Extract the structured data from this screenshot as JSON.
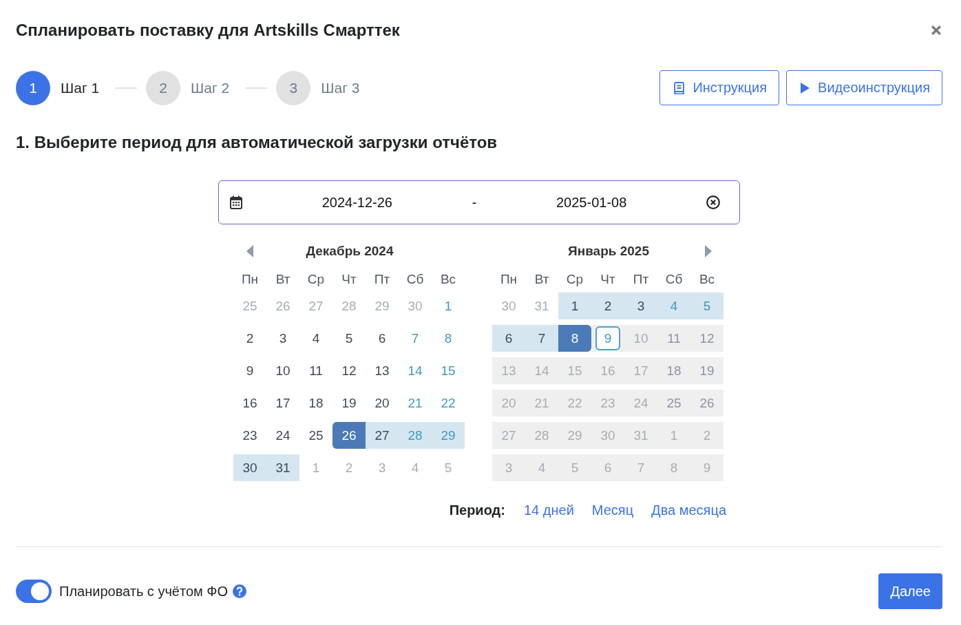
{
  "dialog": {
    "title": "Спланировать поставку для Artskills Смарттек"
  },
  "steps": [
    {
      "number": "1",
      "label": "Шаг 1",
      "selected": true
    },
    {
      "number": "2",
      "label": "Шаг 2",
      "selected": false
    },
    {
      "number": "3",
      "label": "Шаг 3",
      "selected": false
    }
  ],
  "help_buttons": [
    {
      "label": "Инструкция",
      "kind": "doc"
    },
    {
      "label": "Видеоинструкция",
      "kind": "video"
    }
  ],
  "section_title": "1. Выберите период для автоматической загрузки отчётов",
  "date_range": {
    "start": "2024-12-26",
    "separator": "-",
    "end": "2025-01-08"
  },
  "calendars": [
    {
      "title": "Декабрь 2024",
      "prev_arrow": true,
      "next_arrow": false,
      "weekdays": [
        "Пн",
        "Вт",
        "Ср",
        "Чт",
        "Пт",
        "Сб",
        "Вс"
      ],
      "days": [
        {
          "text": "25",
          "kind": "outside",
          "selected": false,
          "in_range": false,
          "disabled": false,
          "today": false
        },
        {
          "text": "26",
          "kind": "outside",
          "selected": false,
          "in_range": false,
          "disabled": false,
          "today": false
        },
        {
          "text": "27",
          "kind": "outside",
          "selected": false,
          "in_range": false,
          "disabled": false,
          "today": false
        },
        {
          "text": "28",
          "kind": "outside",
          "selected": false,
          "in_range": false,
          "disabled": false,
          "today": false
        },
        {
          "text": "29",
          "kind": "outside",
          "selected": false,
          "in_range": false,
          "disabled": false,
          "today": false
        },
        {
          "text": "30",
          "kind": "outside",
          "selected": false,
          "in_range": false,
          "disabled": false,
          "today": false
        },
        {
          "text": "1",
          "kind": "weekend",
          "selected": false,
          "in_range": false,
          "disabled": false,
          "today": false
        },
        {
          "text": "2",
          "kind": "weekday",
          "selected": false,
          "in_range": false,
          "disabled": false,
          "today": false
        },
        {
          "text": "3",
          "kind": "weekday",
          "selected": false,
          "in_range": false,
          "disabled": false,
          "today": false
        },
        {
          "text": "4",
          "kind": "weekday",
          "selected": false,
          "in_range": false,
          "disabled": false,
          "today": false
        },
        {
          "text": "5",
          "kind": "weekday",
          "selected": false,
          "in_range": false,
          "disabled": false,
          "today": false
        },
        {
          "text": "6",
          "kind": "weekday",
          "selected": false,
          "in_range": false,
          "disabled": false,
          "today": false
        },
        {
          "text": "7",
          "kind": "weekend",
          "selected": false,
          "in_range": false,
          "disabled": false,
          "today": false
        },
        {
          "text": "8",
          "kind": "weekend",
          "selected": false,
          "in_range": false,
          "disabled": false,
          "today": false
        },
        {
          "text": "9",
          "kind": "weekday",
          "selected": false,
          "in_range": false,
          "disabled": false,
          "today": false
        },
        {
          "text": "10",
          "kind": "weekday",
          "selected": false,
          "in_range": false,
          "disabled": false,
          "today": false
        },
        {
          "text": "11",
          "kind": "weekday",
          "selected": false,
          "in_range": false,
          "disabled": false,
          "today": false
        },
        {
          "text": "12",
          "kind": "weekday",
          "selected": false,
          "in_range": false,
          "disabled": false,
          "today": false
        },
        {
          "text": "13",
          "kind": "weekday",
          "selected": false,
          "in_range": false,
          "disabled": false,
          "today": false
        },
        {
          "text": "14",
          "kind": "weekend",
          "selected": false,
          "in_range": false,
          "disabled": false,
          "today": false
        },
        {
          "text": "15",
          "kind": "weekend",
          "selected": false,
          "in_range": false,
          "disabled": false,
          "today": false
        },
        {
          "text": "16",
          "kind": "weekday",
          "selected": false,
          "in_range": false,
          "disabled": false,
          "today": false
        },
        {
          "text": "17",
          "kind": "weekday",
          "selected": false,
          "in_range": false,
          "disabled": false,
          "today": false
        },
        {
          "text": "18",
          "kind": "weekday",
          "selected": false,
          "in_range": false,
          "disabled": false,
          "today": false
        },
        {
          "text": "19",
          "kind": "weekday",
          "selected": false,
          "in_range": false,
          "disabled": false,
          "today": false
        },
        {
          "text": "20",
          "kind": "weekday",
          "selected": false,
          "in_range": false,
          "disabled": false,
          "today": false
        },
        {
          "text": "21",
          "kind": "weekend",
          "selected": false,
          "in_range": false,
          "disabled": false,
          "today": false
        },
        {
          "text": "22",
          "kind": "weekend",
          "selected": false,
          "in_range": false,
          "disabled": false,
          "today": false
        },
        {
          "text": "23",
          "kind": "weekday",
          "selected": false,
          "in_range": false,
          "disabled": false,
          "today": false
        },
        {
          "text": "24",
          "kind": "weekday",
          "selected": false,
          "in_range": false,
          "disabled": false,
          "today": false
        },
        {
          "text": "25",
          "kind": "weekday",
          "selected": false,
          "in_range": false,
          "disabled": false,
          "today": false
        },
        {
          "text": "26",
          "kind": "weekday",
          "selected": true,
          "in_range": false,
          "disabled": false,
          "today": false
        },
        {
          "text": "27",
          "kind": "weekday",
          "selected": false,
          "in_range": true,
          "disabled": false,
          "today": false
        },
        {
          "text": "28",
          "kind": "weekend",
          "selected": false,
          "in_range": true,
          "disabled": false,
          "today": false
        },
        {
          "text": "29",
          "kind": "weekend",
          "selected": false,
          "in_range": true,
          "disabled": false,
          "today": false
        },
        {
          "text": "30",
          "kind": "weekday",
          "selected": false,
          "in_range": true,
          "disabled": false,
          "today": false
        },
        {
          "text": "31",
          "kind": "weekday",
          "selected": false,
          "in_range": true,
          "disabled": false,
          "today": false
        },
        {
          "text": "1",
          "kind": "outside",
          "selected": false,
          "in_range": false,
          "disabled": false,
          "today": false
        },
        {
          "text": "2",
          "kind": "outside",
          "selected": false,
          "in_range": false,
          "disabled": false,
          "today": false
        },
        {
          "text": "3",
          "kind": "outside",
          "selected": false,
          "in_range": false,
          "disabled": false,
          "today": false
        },
        {
          "text": "4",
          "kind": "outside",
          "selected": false,
          "in_range": false,
          "disabled": false,
          "today": false
        },
        {
          "text": "5",
          "kind": "outside",
          "selected": false,
          "in_range": false,
          "disabled": false,
          "today": false
        }
      ]
    },
    {
      "title": "Январь 2025",
      "prev_arrow": false,
      "next_arrow": true,
      "weekdays": [
        "Пн",
        "Вт",
        "Ср",
        "Чт",
        "Пт",
        "Сб",
        "Вс"
      ],
      "days": [
        {
          "text": "30",
          "kind": "outside",
          "selected": false,
          "in_range": false,
          "disabled": false,
          "today": false
        },
        {
          "text": "31",
          "kind": "outside",
          "selected": false,
          "in_range": false,
          "disabled": false,
          "today": false
        },
        {
          "text": "1",
          "kind": "weekday",
          "selected": false,
          "in_range": true,
          "disabled": false,
          "today": false
        },
        {
          "text": "2",
          "kind": "weekday",
          "selected": false,
          "in_range": true,
          "disabled": false,
          "today": false
        },
        {
          "text": "3",
          "kind": "weekday",
          "selected": false,
          "in_range": true,
          "disabled": false,
          "today": false
        },
        {
          "text": "4",
          "kind": "weekend",
          "selected": false,
          "in_range": true,
          "disabled": false,
          "today": false
        },
        {
          "text": "5",
          "kind": "weekend",
          "selected": false,
          "in_range": true,
          "disabled": false,
          "today": false
        },
        {
          "text": "6",
          "kind": "weekday",
          "selected": false,
          "in_range": true,
          "disabled": false,
          "today": false
        },
        {
          "text": "7",
          "kind": "weekday",
          "selected": false,
          "in_range": true,
          "disabled": false,
          "today": false
        },
        {
          "text": "8",
          "kind": "weekday",
          "selected": true,
          "in_range": false,
          "disabled": false,
          "today": false
        },
        {
          "text": "9",
          "kind": "weekday",
          "selected": false,
          "in_range": false,
          "disabled": true,
          "today": true
        },
        {
          "text": "10",
          "kind": "weekday",
          "selected": false,
          "in_range": false,
          "disabled": true,
          "today": false
        },
        {
          "text": "11",
          "kind": "weekend",
          "selected": false,
          "in_range": false,
          "disabled": true,
          "today": false
        },
        {
          "text": "12",
          "kind": "weekend",
          "selected": false,
          "in_range": false,
          "disabled": true,
          "today": false
        },
        {
          "text": "13",
          "kind": "weekday",
          "selected": false,
          "in_range": false,
          "disabled": true,
          "today": false
        },
        {
          "text": "14",
          "kind": "weekday",
          "selected": false,
          "in_range": false,
          "disabled": true,
          "today": false
        },
        {
          "text": "15",
          "kind": "weekday",
          "selected": false,
          "in_range": false,
          "disabled": true,
          "today": false
        },
        {
          "text": "16",
          "kind": "weekday",
          "selected": false,
          "in_range": false,
          "disabled": true,
          "today": false
        },
        {
          "text": "17",
          "kind": "weekday",
          "selected": false,
          "in_range": false,
          "disabled": true,
          "today": false
        },
        {
          "text": "18",
          "kind": "weekend",
          "selected": false,
          "in_range": false,
          "disabled": true,
          "today": false
        },
        {
          "text": "19",
          "kind": "weekend",
          "selected": false,
          "in_range": false,
          "disabled": true,
          "today": false
        },
        {
          "text": "20",
          "kind": "weekday",
          "selected": false,
          "in_range": false,
          "disabled": true,
          "today": false
        },
        {
          "text": "21",
          "kind": "weekday",
          "selected": false,
          "in_range": false,
          "disabled": true,
          "today": false
        },
        {
          "text": "22",
          "kind": "weekday",
          "selected": false,
          "in_range": false,
          "disabled": true,
          "today": false
        },
        {
          "text": "23",
          "kind": "weekday",
          "selected": false,
          "in_range": false,
          "disabled": true,
          "today": false
        },
        {
          "text": "24",
          "kind": "weekday",
          "selected": false,
          "in_range": false,
          "disabled": true,
          "today": false
        },
        {
          "text": "25",
          "kind": "weekend",
          "selected": false,
          "in_range": false,
          "disabled": true,
          "today": false
        },
        {
          "text": "26",
          "kind": "weekend",
          "selected": false,
          "in_range": false,
          "disabled": true,
          "today": false
        },
        {
          "text": "27",
          "kind": "weekday",
          "selected": false,
          "in_range": false,
          "disabled": true,
          "today": false
        },
        {
          "text": "28",
          "kind": "weekday",
          "selected": false,
          "in_range": false,
          "disabled": true,
          "today": false
        },
        {
          "text": "29",
          "kind": "weekday",
          "selected": false,
          "in_range": false,
          "disabled": true,
          "today": false
        },
        {
          "text": "30",
          "kind": "weekday",
          "selected": false,
          "in_range": false,
          "disabled": true,
          "today": false
        },
        {
          "text": "31",
          "kind": "weekday",
          "selected": false,
          "in_range": false,
          "disabled": true,
          "today": false
        },
        {
          "text": "1",
          "kind": "outside",
          "selected": false,
          "in_range": false,
          "disabled": true,
          "today": false
        },
        {
          "text": "2",
          "kind": "outside",
          "selected": false,
          "in_range": false,
          "disabled": true,
          "today": false
        },
        {
          "text": "3",
          "kind": "outside",
          "selected": false,
          "in_range": false,
          "disabled": true,
          "today": false
        },
        {
          "text": "4",
          "kind": "outside",
          "selected": false,
          "in_range": false,
          "disabled": true,
          "today": false
        },
        {
          "text": "5",
          "kind": "outside",
          "selected": false,
          "in_range": false,
          "disabled": true,
          "today": false
        },
        {
          "text": "6",
          "kind": "outside",
          "selected": false,
          "in_range": false,
          "disabled": true,
          "today": false
        },
        {
          "text": "7",
          "kind": "outside",
          "selected": false,
          "in_range": false,
          "disabled": true,
          "today": false
        },
        {
          "text": "8",
          "kind": "outside",
          "selected": false,
          "in_range": false,
          "disabled": true,
          "today": false
        },
        {
          "text": "9",
          "kind": "outside",
          "selected": false,
          "in_range": false,
          "disabled": true,
          "today": false
        }
      ]
    }
  ],
  "period": {
    "label": "Период:",
    "options": [
      "14 дней",
      "Месяц",
      "Два месяца"
    ]
  },
  "footer": {
    "toggle": {
      "label": "Планировать с учётом ФО",
      "on": true
    },
    "next_button": "Далее"
  }
}
